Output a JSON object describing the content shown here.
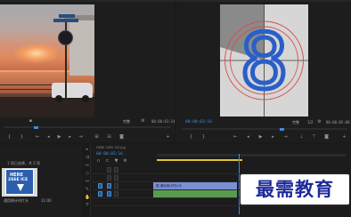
{
  "source_monitor": {
    "fit_label": "完整",
    "duration_label": "00:00:01:14",
    "zoom_icon": "magnify-icon",
    "settings_icon": "wrench-icon"
  },
  "program_monitor": {
    "timecode": "00:00:03:16",
    "fit_label": "完整",
    "half_label": "1/2",
    "duration_label": "00:00:05:00",
    "leader_digit": "8"
  },
  "timeline": {
    "timecode": "00:00:03:16",
    "sequence_label": "序列 01",
    "clip_label": "HERE 2SEE ICE.jpg",
    "clip_text_v1": "图 通用倒计时片头",
    "clip_fx_marker": "fx"
  },
  "project": {
    "header": "项目: 未命名",
    "item_count": "1 项已选择，共 2 项",
    "thumb_title_line1": "HERE",
    "thumb_title_line2": "2SEE ICE",
    "thumb_name": "通用倒计时片头",
    "thumb_duration": "11:00"
  },
  "watermark": {
    "text": "最需教育"
  },
  "colors": {
    "accent": "#3b8de0",
    "clip_v1": "#7b8fd4",
    "clip_a1": "#5a9c4f",
    "timebar": "#e0c13a"
  }
}
